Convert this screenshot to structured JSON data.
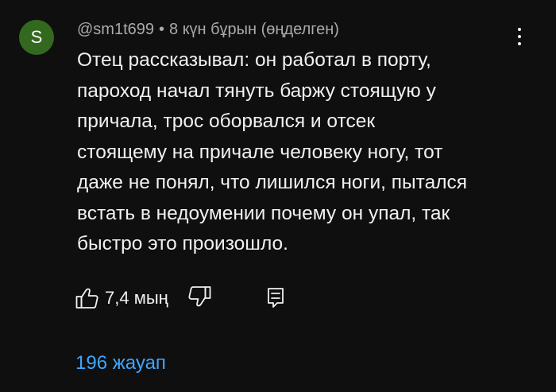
{
  "comment": {
    "avatar_letter": "S",
    "author": "@sm1t699",
    "separator": "•",
    "time_ago": "8 күн бұрын (өңделген)",
    "text_lines": [
      "Отец рассказывал: он работал в порту,",
      "пароход начал тянуть баржу стоящую у",
      "причала, трос оборвался и отсек",
      "стоящему на причале человеку ногу, тот",
      "даже не понял, что лишился ноги, пытался",
      "встать в недоумении почему он упал, так",
      "быстро это произошло."
    ],
    "like_count": "7,4 мың",
    "replies_label": "196 жауап"
  },
  "colors": {
    "background": "#0f0f0f",
    "avatar_bg": "#33691e",
    "meta_text": "#aaaaaa",
    "body_text": "#f1f1f1",
    "link": "#3ea6ff"
  },
  "icons": {
    "menu": "more-vert-icon",
    "like": "thumb-up-icon",
    "dislike": "thumb-down-icon",
    "reply": "reply-comment-icon"
  }
}
